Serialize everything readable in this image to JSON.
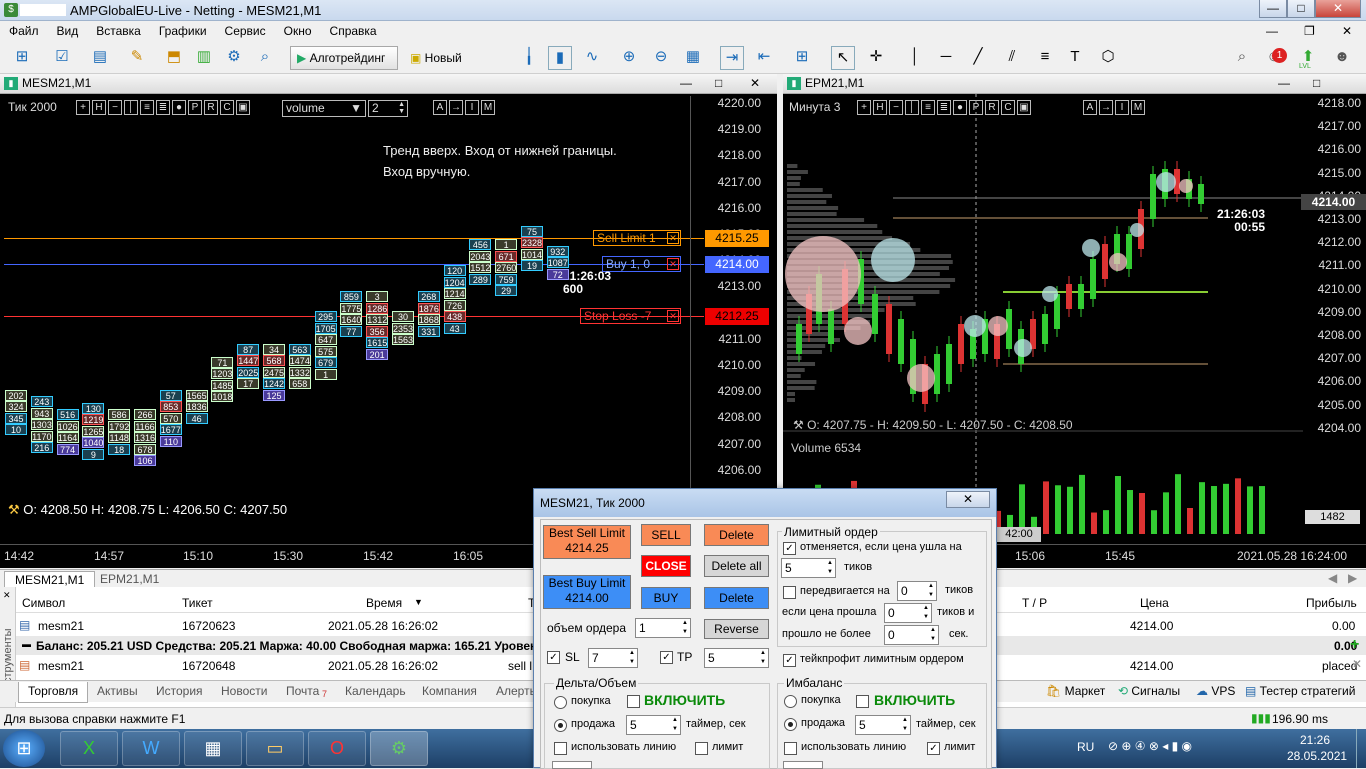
{
  "app": {
    "title": "AMPGlobalEU-Live - Netting - MESM21,M1",
    "window_controls": [
      "—",
      "□",
      "✕"
    ]
  },
  "menu": [
    "Файл",
    "Вид",
    "Вставка",
    "Графики",
    "Сервис",
    "Окно",
    "Справка"
  ],
  "toolbar": {
    "algo_label": "Алготрейдинг",
    "new_order_label": "Новый ордер",
    "badge": "1",
    "lvl": "LVL"
  },
  "left_chart": {
    "title": "MESM21,M1",
    "period_label": "Тик  2000",
    "indicator_select": "volume",
    "indicator_param": "2",
    "annotation_line1": "Тренд вверх. Вход от нижней границы.",
    "annotation_line2": "Вход вручную.",
    "sell_limit_label": "Sell Limit  1",
    "buy_label": "Buy  1,  0",
    "stop_loss_label": "Stop Loss  -7",
    "sell_price": "4215.25",
    "buy_price": "4214.00",
    "stop_price": "4212.25",
    "timer_time": "21:26:03",
    "timer_count": "600",
    "ohlc": "O: 4208.50   H: 4208.75   L: 4206.50   C: 4207.50",
    "prices": [
      "4220.00",
      "4219.00",
      "4218.00",
      "4217.00",
      "4216.00",
      "4215.00",
      "4214.00",
      "4213.00",
      "4212.00",
      "4211.00",
      "4210.00",
      "4209.00",
      "4208.00",
      "4207.00",
      "4206.00"
    ],
    "times": [
      "14:42",
      "14:57",
      "15:10",
      "15:30",
      "15:42",
      "16:05"
    ],
    "clusters": [
      {
        "col": 0,
        "top": 4209.25,
        "cells": [
          [
            "202",
            "g"
          ],
          [
            "324",
            "g"
          ],
          [
            "345",
            "b"
          ],
          [
            "10",
            "b"
          ]
        ]
      },
      {
        "col": 1,
        "top": 4209.0,
        "cells": [
          [
            "243",
            "b"
          ],
          [
            "943",
            "g"
          ],
          [
            "1303",
            "g"
          ],
          [
            "1170",
            "g"
          ],
          [
            "216",
            "b"
          ]
        ]
      },
      {
        "col": 2,
        "top": 4208.5,
        "cells": [
          [
            "516",
            "b"
          ],
          [
            "1026",
            "g"
          ],
          [
            "1164",
            "g"
          ],
          [
            "774",
            "p"
          ]
        ]
      },
      {
        "col": 3,
        "top": 4208.75,
        "cells": [
          [
            "130",
            "b"
          ],
          [
            "1219",
            "r"
          ],
          [
            "1265",
            "g"
          ],
          [
            "1040",
            "p"
          ],
          [
            "9",
            "b"
          ]
        ]
      },
      {
        "col": 4,
        "top": 4208.5,
        "cells": [
          [
            "586",
            "g"
          ],
          [
            "1792",
            "g"
          ],
          [
            "1148",
            "g"
          ],
          [
            "18",
            "b"
          ]
        ]
      },
      {
        "col": 5,
        "top": 4208.5,
        "cells": [
          [
            "266",
            "g"
          ],
          [
            "1166",
            "g"
          ],
          [
            "1316",
            "g"
          ],
          [
            "678",
            "g"
          ],
          [
            "106",
            "p"
          ]
        ]
      },
      {
        "col": 6,
        "top": 4209.25,
        "cells": [
          [
            "57",
            "b"
          ],
          [
            "853",
            "r"
          ],
          [
            "570",
            "g"
          ],
          [
            "1677",
            "b"
          ],
          [
            "110",
            "p"
          ]
        ]
      },
      {
        "col": 7,
        "top": 4209.25,
        "cells": [
          [
            "1565",
            "g"
          ],
          [
            "1836",
            "g"
          ],
          [
            "46",
            "b"
          ]
        ]
      },
      {
        "col": 8,
        "top": 4210.5,
        "cells": [
          [
            "71",
            "g"
          ],
          [
            "1203",
            "g"
          ],
          [
            "1485",
            "g"
          ],
          [
            "1018",
            "g"
          ]
        ]
      },
      {
        "col": 9,
        "top": 4211.0,
        "cells": [
          [
            "87",
            "b"
          ],
          [
            "1447",
            "r"
          ],
          [
            "2025",
            "b"
          ],
          [
            "17",
            "g"
          ]
        ]
      },
      {
        "col": 10,
        "top": 4211.0,
        "cells": [
          [
            "34",
            "g"
          ],
          [
            "568",
            "r"
          ],
          [
            "2475",
            "g"
          ],
          [
            "1242",
            "b"
          ],
          [
            "125",
            "p"
          ]
        ]
      },
      {
        "col": 11,
        "top": 4211.0,
        "cells": [
          [
            "563",
            "b"
          ],
          [
            "1474",
            "g"
          ],
          [
            "1332",
            "g"
          ],
          [
            "658",
            "g"
          ]
        ]
      },
      {
        "col": 12,
        "top": 4212.25,
        "cells": [
          [
            "295",
            "b"
          ],
          [
            "1705",
            "b"
          ],
          [
            "647",
            "g"
          ],
          [
            "575",
            "g"
          ],
          [
            "679",
            "b"
          ],
          [
            "1",
            "g"
          ]
        ]
      },
      {
        "col": 13,
        "top": 4213.0,
        "cells": [
          [
            "859",
            "b"
          ],
          [
            "1775",
            "g"
          ],
          [
            "1640",
            "g"
          ],
          [
            "77",
            "b"
          ]
        ]
      },
      {
        "col": 14,
        "top": 4213.0,
        "cells": [
          [
            "3",
            "g"
          ],
          [
            "1286",
            "r"
          ],
          [
            "1312",
            "g"
          ],
          [
            "356",
            "r"
          ],
          [
            "1615",
            "b"
          ],
          [
            "201",
            "p"
          ]
        ]
      },
      {
        "col": 15,
        "top": 4212.25,
        "cells": [
          [
            "30",
            "g"
          ],
          [
            "2353",
            "g"
          ],
          [
            "1563",
            "g"
          ]
        ]
      },
      {
        "col": 16,
        "top": 4213.0,
        "cells": [
          [
            "268",
            "b"
          ],
          [
            "1876",
            "r"
          ],
          [
            "1868",
            "g"
          ],
          [
            "331",
            "b"
          ]
        ]
      },
      {
        "col": 17,
        "top": 4214.0,
        "cells": [
          [
            "120",
            "b"
          ],
          [
            "1204",
            "b"
          ],
          [
            "1214",
            "g"
          ],
          [
            "726",
            "g"
          ],
          [
            "438",
            "r"
          ],
          [
            "43",
            "b"
          ]
        ]
      },
      {
        "col": 18,
        "top": 4215.0,
        "cells": [
          [
            "456",
            "b"
          ],
          [
            "2043",
            "g"
          ],
          [
            "1512",
            "g"
          ],
          [
            "289",
            "b"
          ]
        ]
      },
      {
        "col": 19,
        "top": 4215.0,
        "cells": [
          [
            "1",
            "g"
          ],
          [
            "671",
            "r"
          ],
          [
            "2760",
            "g"
          ],
          [
            "759",
            "b"
          ],
          [
            "29",
            "b"
          ]
        ]
      },
      {
        "col": 20,
        "top": 4215.5,
        "cells": [
          [
            "75",
            "b"
          ],
          [
            "2328",
            "r"
          ],
          [
            "1014",
            "g"
          ],
          [
            "19",
            "b"
          ]
        ]
      },
      {
        "col": 21,
        "top": 4214.75,
        "cells": [
          [
            "932",
            "b"
          ],
          [
            "1087",
            "b"
          ],
          [
            "72",
            "p"
          ]
        ]
      }
    ]
  },
  "right_chart": {
    "title": "EPM21,M1",
    "period_label": "Минута  3",
    "prices": [
      "4218.00",
      "4217.00",
      "4216.00",
      "4215.00",
      "4214.00",
      "4213.00",
      "4212.00",
      "4211.00",
      "4210.00",
      "4209.00",
      "4208.00",
      "4207.00",
      "4206.00",
      "4205.00",
      "4204.00"
    ],
    "current_price": "4214.00",
    "timer_time": "21:26:03",
    "timer_count": "00:55",
    "ohlc": "O: 4207.75 - H: 4209.50 - L: 4207.50 - C: 4208.50",
    "volume_label": "Volume 6534",
    "volume_value": "1482",
    "time_cursor": "42:00",
    "times": [
      "15:06",
      "15:45",
      "2021.05.28 16:24:00"
    ]
  },
  "chart_tabs": [
    "MESM21,M1",
    "EPM21,M1"
  ],
  "toolbox": {
    "columns": [
      "Символ",
      "Тикет",
      "Время",
      "Т",
      "T / P",
      "Цена",
      "Прибыль"
    ],
    "rows": [
      {
        "symbol": "mesm21",
        "ticket": "16720623",
        "time": "2021.05.28 16:26:02",
        "tp": "",
        "price": "4214.00",
        "profit": "0.00"
      },
      {
        "symbol": "mesm21",
        "ticket": "16720648",
        "time": "2021.05.28 16:26:02",
        "type": "sell l",
        "price": "4214.00",
        "profit": "placed"
      }
    ],
    "balance": "Баланс: 205.21 USD  Средства: 205.21  Маржа: 40.00  Свободная маржа: 165.21  Уровень марж",
    "balance_profit": "0.00",
    "side_label": "Инструменты",
    "tabs": [
      "Торговля",
      "Активы",
      "История",
      "Новости",
      "Почта",
      "Календарь",
      "Компания",
      "Алерты"
    ],
    "mail_count": "7",
    "right_tabs": [
      "Маркет",
      "Сигналы",
      "VPS",
      "Тестер стратегий"
    ]
  },
  "status": {
    "help": "Для вызова справки нажмите F1",
    "ping": "196.90 ms"
  },
  "taskbar": {
    "lang": "RU",
    "time": "21:26",
    "date": "28.05.2021"
  },
  "dialog": {
    "title": "MESM21, Тик  2000",
    "best_sell": "Best Sell Limit",
    "best_sell_price": "4214.25",
    "best_buy": "Best Buy Limit",
    "best_buy_price": "4214.00",
    "sell": "SELL",
    "close": "CLOSE",
    "buy": "BUY",
    "delete": "Delete",
    "delete_all": "Delete all",
    "delete2": "Delete",
    "reverse": "Reverse",
    "volume_label": "объем ордера",
    "volume_value": "1",
    "sl_label": "SL",
    "sl_value": "7",
    "tp_label": "TP",
    "tp_value": "5",
    "limit_group": "Лимитный ордер",
    "cancel_label": "отменяется, если цена ушла на",
    "cancel_value": "5",
    "ticks": "тиков",
    "move_label": "передвигается на",
    "move_value": "0",
    "move_ticks": "тиков",
    "if_moved": "если цена прошла",
    "if_moved_value": "0",
    "if_ticks": "тиков и",
    "no_more": "прошло не более",
    "no_more_value": "0",
    "sec": "сек.",
    "tp_limit": "тейкпрофит лимитным ордером",
    "delta_group": "Дельта/Объем",
    "imb_group": "Имбаланс",
    "purchase": "покупка",
    "sale": "продажа",
    "enable": "ВКЛЮЧИТЬ",
    "timer_label": "таймер, сек",
    "delta_timer": "5",
    "imb_timer": "5",
    "use_line": "использовать линию",
    "limit": "лимит"
  }
}
